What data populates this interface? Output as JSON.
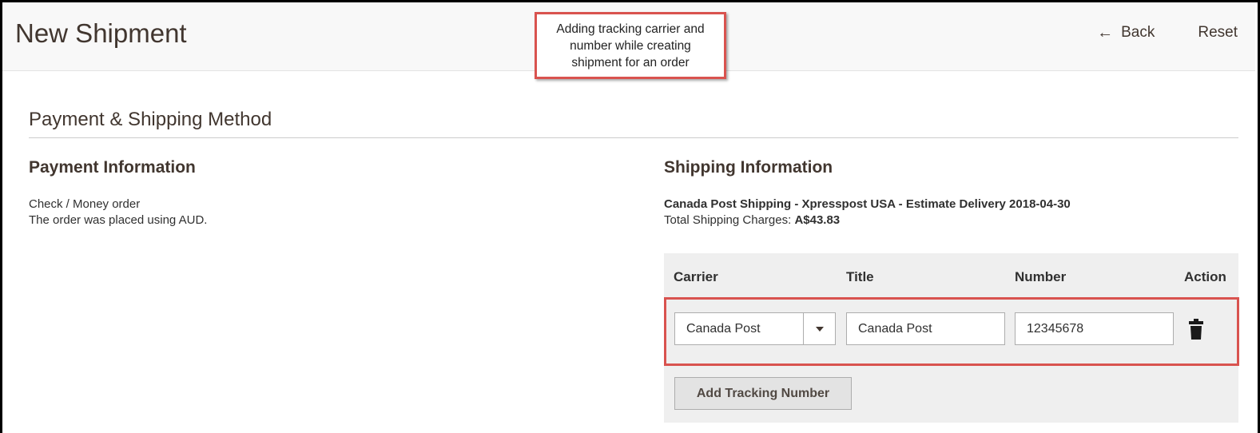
{
  "header": {
    "title": "New Shipment",
    "back_label": "Back",
    "reset_label": "Reset"
  },
  "callout": {
    "lines": [
      "Adding tracking carrier and",
      "number while creating",
      "shipment for an order"
    ]
  },
  "section": {
    "title": "Payment & Shipping Method"
  },
  "payment": {
    "title": "Payment Information",
    "method": "Check / Money order",
    "currency_note": "The order was placed using AUD."
  },
  "shipping": {
    "title": "Shipping Information",
    "method": "Canada Post Shipping - Xpresspost USA - Estimate Delivery 2018-04-30",
    "charges_label": "Total Shipping Charges:",
    "charges_value": "A$43.83"
  },
  "tracking": {
    "columns": {
      "carrier": "Carrier",
      "title": "Title",
      "number": "Number",
      "action": "Action"
    },
    "row": {
      "carrier": "Canada Post",
      "title": "Canada Post",
      "number": "12345678"
    },
    "add_button": "Add Tracking Number"
  },
  "colors": {
    "highlight": "#d9534f",
    "header_bg": "#f8f8f8",
    "panel_bg": "#efefef"
  },
  "icons": {
    "back": "arrow-left-icon",
    "select": "chevron-down-icon",
    "delete": "trash-icon"
  }
}
